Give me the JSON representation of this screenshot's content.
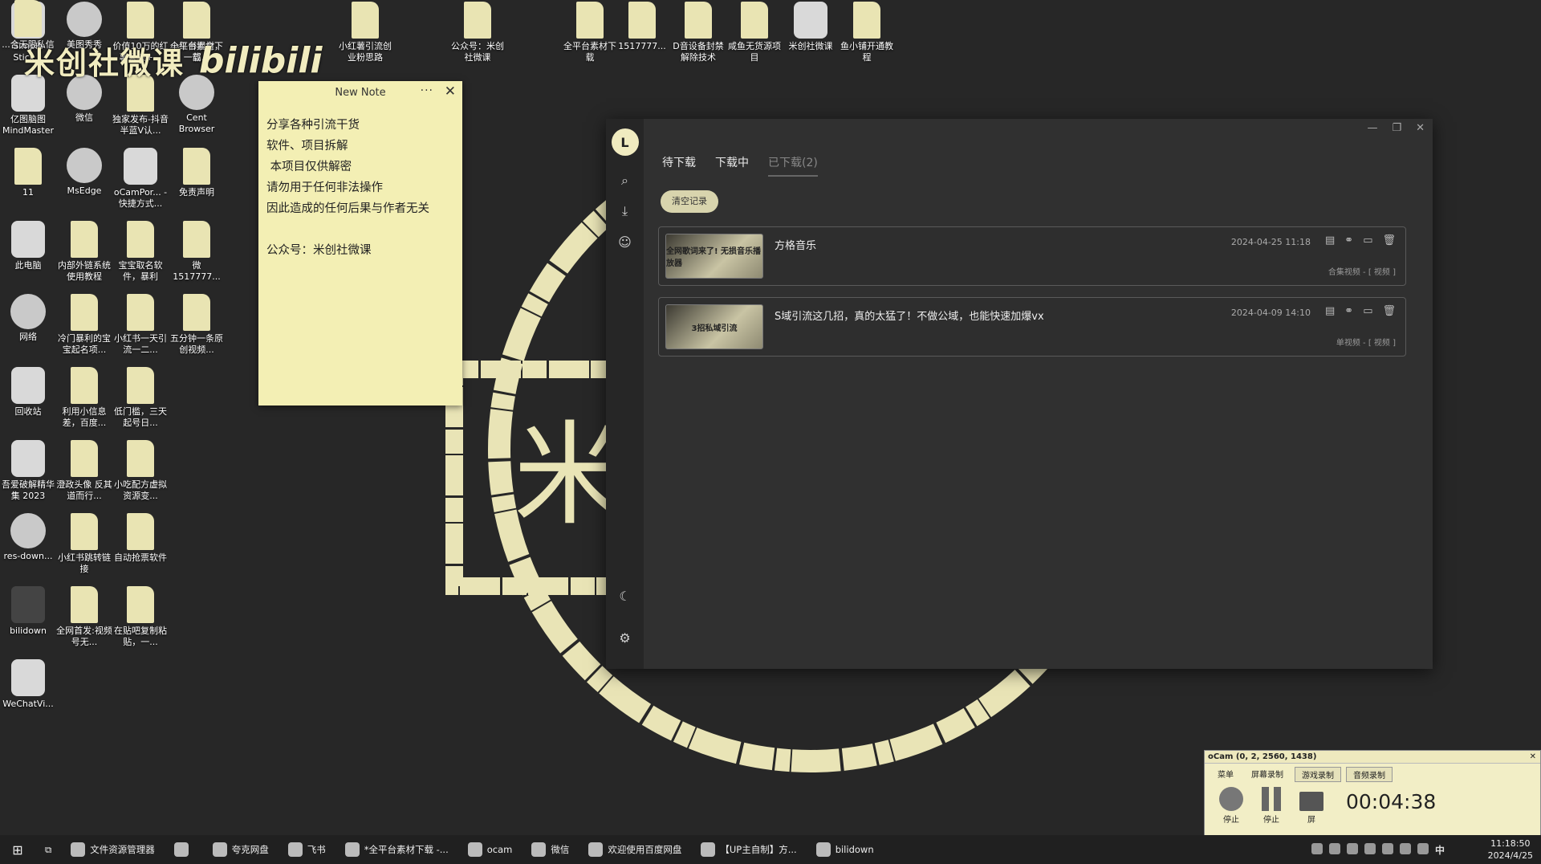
{
  "watermark": {
    "text": "米创社微课",
    "brand": "bilibili"
  },
  "desktop_icons": [
    {
      "label": "Simple Stick...",
      "kind": "app"
    },
    {
      "label": "亿图脑图 MindMaster",
      "kind": "app"
    },
    {
      "label": "11",
      "kind": "file"
    },
    {
      "label": "此电脑",
      "kind": "app"
    },
    {
      "label": "网络",
      "kind": "round"
    },
    {
      "label": "回收站",
      "kind": "app"
    },
    {
      "label": "吾爱破解精华集 2023",
      "kind": "app"
    },
    {
      "label": "res-down...",
      "kind": "round"
    },
    {
      "label": "bilidown",
      "kind": "dark"
    },
    {
      "label": "WeChatVi...",
      "kind": "app"
    },
    {
      "label": "美图秀秀",
      "kind": "round"
    },
    {
      "label": "微信",
      "kind": "round"
    },
    {
      "label": "MsEdge",
      "kind": "round"
    },
    {
      "label": "内部外链系统使用教程",
      "kind": "file"
    },
    {
      "label": "冷门暴利的宝宝起名项...",
      "kind": "file"
    },
    {
      "label": "利用小信息差，百度...",
      "kind": "file"
    },
    {
      "label": "澄政头像 反其道而行...",
      "kind": "file"
    },
    {
      "label": "小红书跳转链接",
      "kind": "file"
    },
    {
      "label": "全网首发:视频号无...",
      "kind": "file"
    },
    {
      "label": "价值10万的红薯采集+...",
      "kind": "file"
    },
    {
      "label": "独家发布-抖音半蓝V认...",
      "kind": "file"
    },
    {
      "label": "oCamPor... - 快捷方式...",
      "kind": "app"
    },
    {
      "label": "宝宝取名软件，暴利",
      "kind": "file"
    },
    {
      "label": "小红书一天引流一二...",
      "kind": "file"
    },
    {
      "label": "低门槛，三天起号日...",
      "kind": "file"
    },
    {
      "label": "小吃配方虚拟资源变...",
      "kind": "file"
    },
    {
      "label": "自动抢票软件",
      "kind": "file"
    },
    {
      "label": "在贴吧复制粘贴，一...",
      "kind": "file"
    },
    {
      "label": "小红书掘金，一部...",
      "kind": "file"
    },
    {
      "label": "Cent Browser",
      "kind": "round"
    },
    {
      "label": "免责声明",
      "kind": "file"
    },
    {
      "label": "微 1517777...",
      "kind": "file"
    },
    {
      "label": "五分钟一条原创视频...",
      "kind": "file"
    },
    {
      "label": "小红薯引流创业粉思路",
      "kind": "file"
    },
    {
      "label": "公众号：米创社微课",
      "kind": "file"
    },
    {
      "label": "全平台素材下载",
      "kind": "file"
    },
    {
      "label": "1517777...",
      "kind": "file"
    },
    {
      "label": "D音设备封禁解除技术",
      "kind": "file"
    },
    {
      "label": "咸鱼无货源项目",
      "kind": "file"
    },
    {
      "label": "米创社微课",
      "kind": "app"
    },
    {
      "label": "鱼小铺开通教程",
      "kind": "file"
    },
    {
      "label": "全平台素材下载",
      "kind": "file"
    },
    {
      "label": "...合无限私信",
      "kind": "file"
    }
  ],
  "note": {
    "title": "New Note",
    "lines": [
      "分享各种引流干货",
      "软件、项目拆解",
      " 本项目仅供解密",
      "请勿用于任何非法操作",
      "因此造成的任何后果与作者无关",
      "",
      "公众号：米创社微课"
    ]
  },
  "downloader": {
    "logo": "L",
    "tabs": [
      "待下载",
      "下载中",
      "已下载(2)"
    ],
    "clear_label": "清空记录",
    "tasks": [
      {
        "title": "方格音乐",
        "date": "2024-04-25 11:18",
        "meta": "合集视频 - [ 视频 ]",
        "thumb_text": "全网歌词来了! 无损音乐播放器"
      },
      {
        "title": "S域引流这几招，真的太猛了！不做公域，也能快速加爆vx",
        "date": "2024-04-09 14:10",
        "meta": "单视频 - [ 视频 ]",
        "thumb_text": "3招私域引流"
      }
    ]
  },
  "ocam": {
    "title": "oCam (0, 2, 2560, 1438)",
    "menu": [
      "菜单",
      "屏幕录制",
      "游戏录制",
      "音频录制"
    ],
    "stop1": "停止",
    "stop2": "停止",
    "screen_label": "屏",
    "timer": "00:04:38"
  },
  "taskbar": {
    "items": [
      "文件资源管理器",
      "",
      "夸克网盘",
      "飞书",
      "*全平台素材下载 -...",
      "ocam",
      "微信",
      "欢迎使用百度网盘",
      "【UP主自制】方...",
      "bilidown"
    ],
    "ime": "中",
    "time": "11:18:50",
    "date": "2024/4/25"
  },
  "colors": {
    "accent": "#f0ebc0",
    "wallpaper": "#262626"
  }
}
